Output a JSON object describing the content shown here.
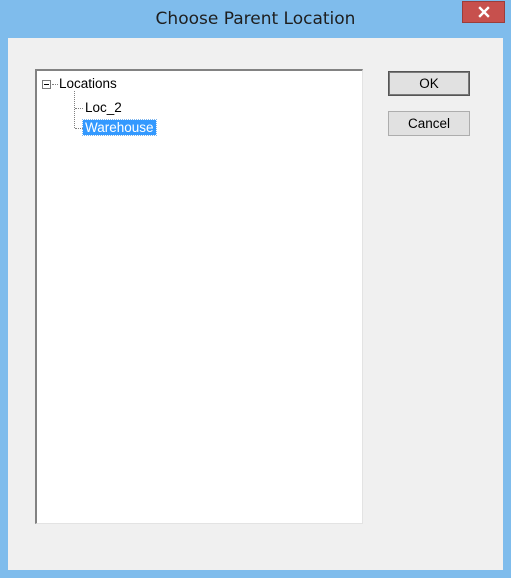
{
  "window": {
    "title": "Choose Parent Location",
    "close_glyph": "x"
  },
  "tree": {
    "root": {
      "label": "Locations",
      "expanded": true
    },
    "children": [
      {
        "label": "Loc_2",
        "selected": false
      },
      {
        "label": "Warehouse",
        "selected": true
      }
    ]
  },
  "buttons": {
    "ok_label": "OK",
    "cancel_label": "Cancel"
  },
  "colors": {
    "frame": "#7fbcec",
    "close_button": "#c7504d",
    "selection": "#3399ff",
    "client": "#f0f0f0"
  },
  "icons": {
    "close": "close-icon",
    "expander": "collapse-icon"
  }
}
